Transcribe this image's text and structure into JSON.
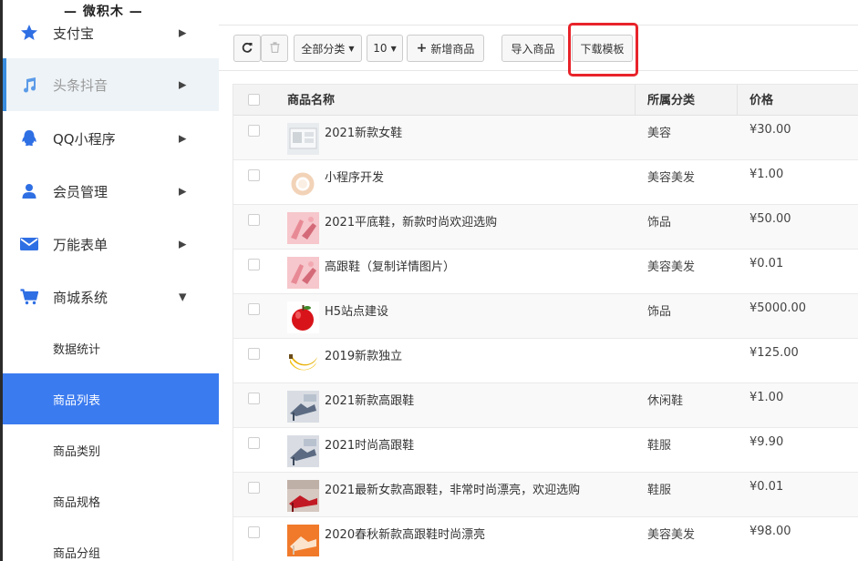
{
  "logo": "— 微积木 —",
  "sidebar": {
    "menu": [
      {
        "label": "支付宝",
        "icon": "star-icon",
        "arrow": "▶"
      },
      {
        "label": "头条抖音",
        "icon": "music-note-icon",
        "arrow": "▶"
      },
      {
        "label": "QQ小程序",
        "icon": "qq-penguin-icon",
        "arrow": "▶"
      },
      {
        "label": "会员管理",
        "icon": "user-icon",
        "arrow": "▶"
      },
      {
        "label": "万能表单",
        "icon": "envelope-icon",
        "arrow": "▶"
      },
      {
        "label": "商城系统",
        "icon": "shopping-cart-icon",
        "arrow": "▼"
      }
    ],
    "submenu": [
      {
        "label": "数据统计"
      },
      {
        "label": "商品列表"
      },
      {
        "label": "商品类别"
      },
      {
        "label": "商品规格"
      },
      {
        "label": "商品分组"
      }
    ]
  },
  "toolbar": {
    "refresh_icon": "refresh-icon",
    "delete_icon": "trash-icon",
    "category_filter": "全部分类",
    "page_size": "10",
    "add_label": "新增商品",
    "import_label": "导入商品",
    "download_label": "下载模板"
  },
  "table": {
    "headers": {
      "name": "商品名称",
      "category": "所属分类",
      "price": "价格"
    },
    "rows": [
      {
        "name": "2021新款女鞋",
        "category": "美容",
        "price": "¥30.00",
        "thumb": "shoe-photo"
      },
      {
        "name": "小程序开发",
        "category": "美容美发",
        "price": "¥1.00",
        "thumb": "ring-photo"
      },
      {
        "name": "2021平底鞋，新款时尚欢迎选购",
        "category": "饰品",
        "price": "¥50.00",
        "thumb": "pink-shoe-photo"
      },
      {
        "name": "高跟鞋（复制详情图片）",
        "category": "美容美发",
        "price": "¥0.01",
        "thumb": "pink-shoe-photo"
      },
      {
        "name": "H5站点建设",
        "category": "饰品",
        "price": "¥5000.00",
        "thumb": "apple-photo"
      },
      {
        "name": "2019新款独立",
        "category": "",
        "price": "¥125.00",
        "thumb": "banana-photo"
      },
      {
        "name": "2021新款高跟鞋",
        "category": "休闲鞋",
        "price": "¥1.00",
        "thumb": "heels-photo"
      },
      {
        "name": "2021时尚高跟鞋",
        "category": "鞋服",
        "price": "¥9.90",
        "thumb": "heels-photo"
      },
      {
        "name": "2021最新女款高跟鞋，非常时尚漂亮，欢迎选购",
        "category": "鞋服",
        "price": "¥0.01",
        "thumb": "red-heels-photo"
      },
      {
        "name": "2020春秋新款高跟鞋时尚漂亮",
        "category": "美容美发",
        "price": "¥98.00",
        "thumb": "orange-heels-photo"
      }
    ]
  },
  "colors": {
    "active": "#3b7bf0",
    "highlight": "#e8232a",
    "sidebar_icon": "#2f6fe4"
  }
}
